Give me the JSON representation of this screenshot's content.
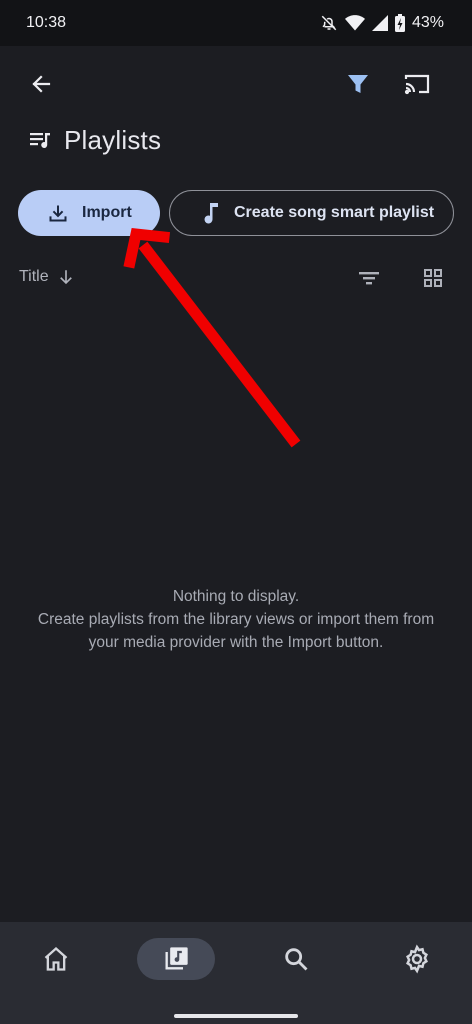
{
  "status": {
    "time": "10:38",
    "battery": "43%"
  },
  "header": {
    "title": "Playlists"
  },
  "actions": {
    "import_label": "Import",
    "smart_playlist_label": "Create song smart playlist"
  },
  "sort": {
    "label": "Title"
  },
  "empty": {
    "line1": "Nothing to display.",
    "line2": "Create playlists from the library views or import them from",
    "line3": "your media provider with the Import button."
  },
  "icons": {
    "back": "arrow-back-icon",
    "filter": "filter-icon",
    "cast": "cast-icon",
    "playlist": "playlist-icon",
    "download": "download-icon",
    "music_note": "music-note-icon",
    "sort_direction": "arrow-down-icon",
    "sort_filter": "filter-list-icon",
    "grid": "grid-view-icon",
    "home": "home-icon",
    "library": "library-music-icon",
    "search": "search-icon",
    "settings": "settings-icon"
  },
  "colors": {
    "accent": "#b9cdf6",
    "filter_active": "#9cc0f2",
    "annotation_arrow": "#f00000",
    "background": "#1c1d22"
  }
}
